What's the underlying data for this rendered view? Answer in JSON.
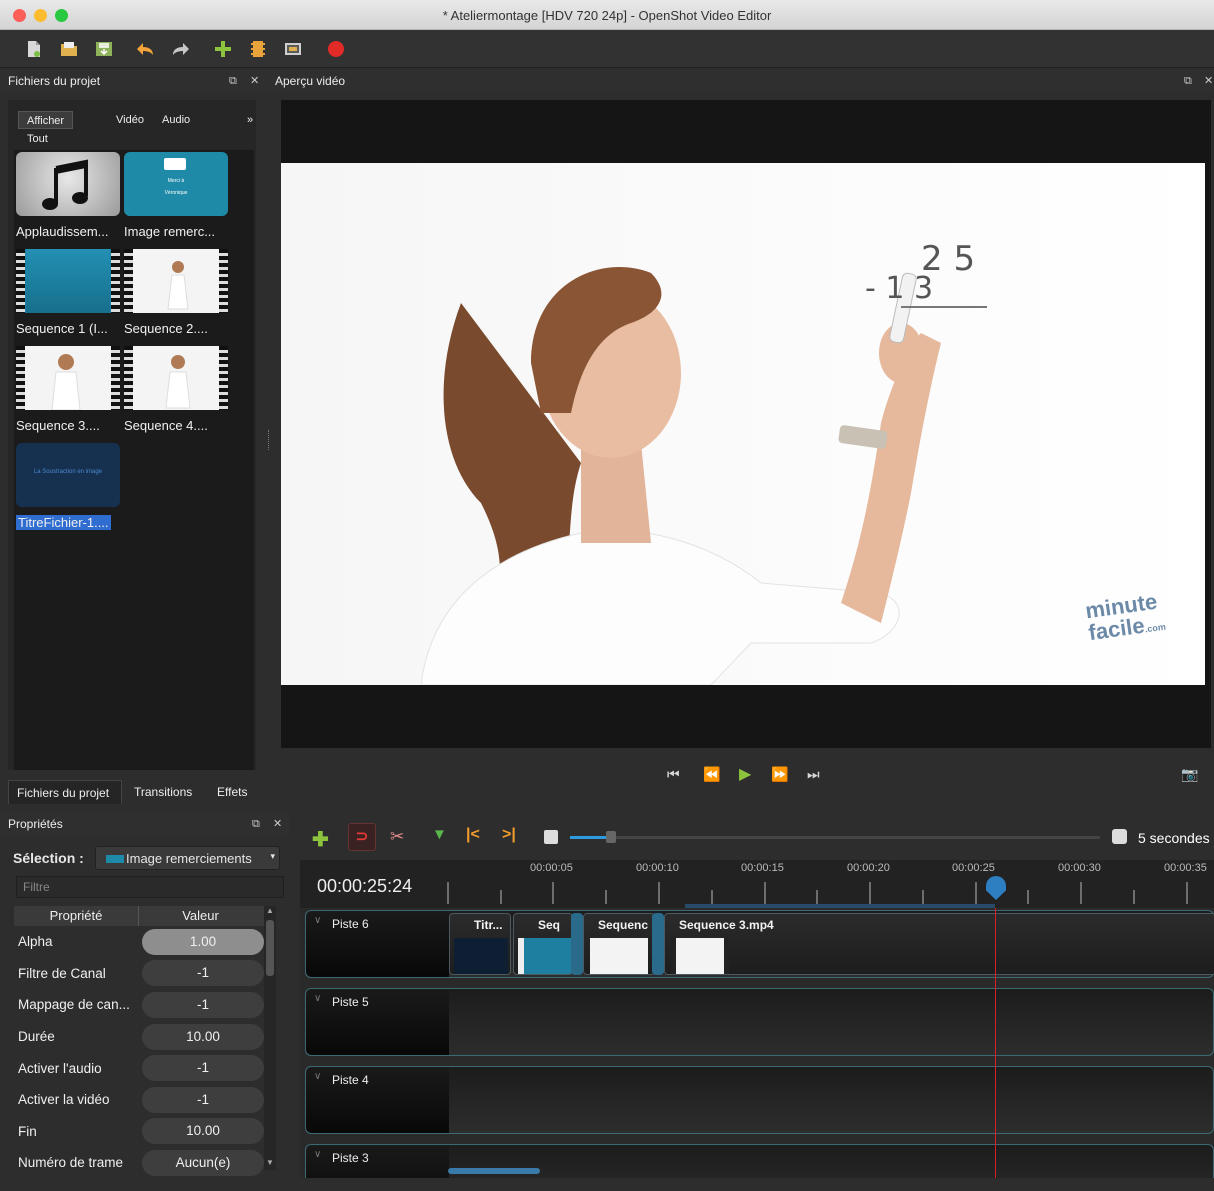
{
  "window": {
    "title": "* Ateliermontage [HDV 720 24p] - OpenShot Video Editor",
    "traffic_colors": [
      "#fc5f57",
      "#fdbc2e",
      "#28c840"
    ]
  },
  "toolbar": {
    "icons": [
      "new-project-icon",
      "open-project-icon",
      "save-project-icon",
      "undo-icon",
      "redo-icon",
      "import-files-icon",
      "profile-icon",
      "fullscreen-icon",
      "export-icon"
    ]
  },
  "project_files": {
    "header": "Fichiers du projet",
    "filter_tabs": [
      "Afficher Tout",
      "Vidéo",
      "Audio"
    ],
    "more": "»",
    "items": [
      {
        "label": "Applaudissem..."
      },
      {
        "label": "Image remerc..."
      },
      {
        "label": "Sequence 1 (I..."
      },
      {
        "label": "Sequence 2...."
      },
      {
        "label": "Sequence 3...."
      },
      {
        "label": "Sequence 4...."
      },
      {
        "label": "TitreFichier-1...."
      }
    ],
    "thumb_text": {
      "image_line1": "Merci à",
      "image_line2": "Véronique",
      "title_thumb": "La Soustraction en image"
    }
  },
  "left_tabs": [
    "Fichiers du projet",
    "Transitions",
    "Effets"
  ],
  "properties": {
    "header": "Propriétés",
    "selection_label": "Sélection :",
    "selection_value": "Image remerciements",
    "filter_placeholder": "Filtre",
    "col_property": "Propriété",
    "col_value": "Valeur",
    "rows": [
      {
        "name": "Alpha",
        "value": "1.00"
      },
      {
        "name": "Filtre de Canal",
        "value": "-1"
      },
      {
        "name": "Mappage de can...",
        "value": "-1"
      },
      {
        "name": "Durée",
        "value": "10.00"
      },
      {
        "name": "Activer l'audio",
        "value": "-1"
      },
      {
        "name": "Activer la vidéo",
        "value": "-1"
      },
      {
        "name": "Fin",
        "value": "10.00"
      },
      {
        "name": "Numéro de trame",
        "value": "Aucun(e)"
      }
    ]
  },
  "preview": {
    "header": "Aperçu vidéo",
    "board_text_top": "2 5",
    "board_text_bottom": "- 1 3",
    "watermark_line1": "minute",
    "watermark_line2": "facile",
    "watermark_suffix": ".com"
  },
  "timeline": {
    "zoom_label": "5 secondes",
    "current_time": "00:00:25:24",
    "ruler_labels": [
      "00:00:05",
      "00:00:10",
      "00:00:15",
      "00:00:20",
      "00:00:25",
      "00:00:30",
      "00:00:35"
    ],
    "tracks": [
      {
        "name": "Piste 6"
      },
      {
        "name": "Piste 5"
      },
      {
        "name": "Piste 4"
      },
      {
        "name": "Piste 3"
      }
    ],
    "clips": [
      {
        "title": "Titr..."
      },
      {
        "title": "Seq"
      },
      {
        "title": "Sequenc"
      },
      {
        "title": "Sequence 3.mp4"
      }
    ],
    "playhead_color": "#d8202a"
  }
}
